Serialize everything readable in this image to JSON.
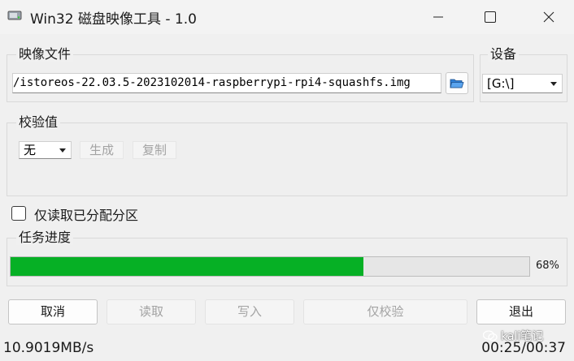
{
  "window": {
    "title": "Win32 磁盘映像工具 - 1.0",
    "controls": [
      "minimize-icon",
      "maximize-icon",
      "close-icon"
    ]
  },
  "image_file": {
    "label": "映像文件",
    "path": "/istoreos-22.03.5-2023102014-raspberrypi-rpi4-squashfs.img",
    "browse_icon": "folder-icon"
  },
  "device": {
    "label": "设备",
    "selected": "[G:\\]"
  },
  "hash": {
    "label": "校验值",
    "type_selected": "无",
    "generate_label": "生成",
    "copy_label": "复制"
  },
  "options": {
    "read_only_allocated_label": "仅读取已分配分区",
    "read_only_allocated_checked": false
  },
  "progress": {
    "label": "任务进度",
    "percent_text": "68%",
    "fraction": 0.68,
    "color": "#06b025"
  },
  "buttons": {
    "cancel": "取消",
    "read": "读取",
    "write": "写入",
    "verify_only": "仅校验",
    "exit": "退出"
  },
  "status": {
    "speed": "10.9019MB/s",
    "time": "00:25/00:37"
  },
  "watermark": {
    "text": "kali笔记"
  }
}
